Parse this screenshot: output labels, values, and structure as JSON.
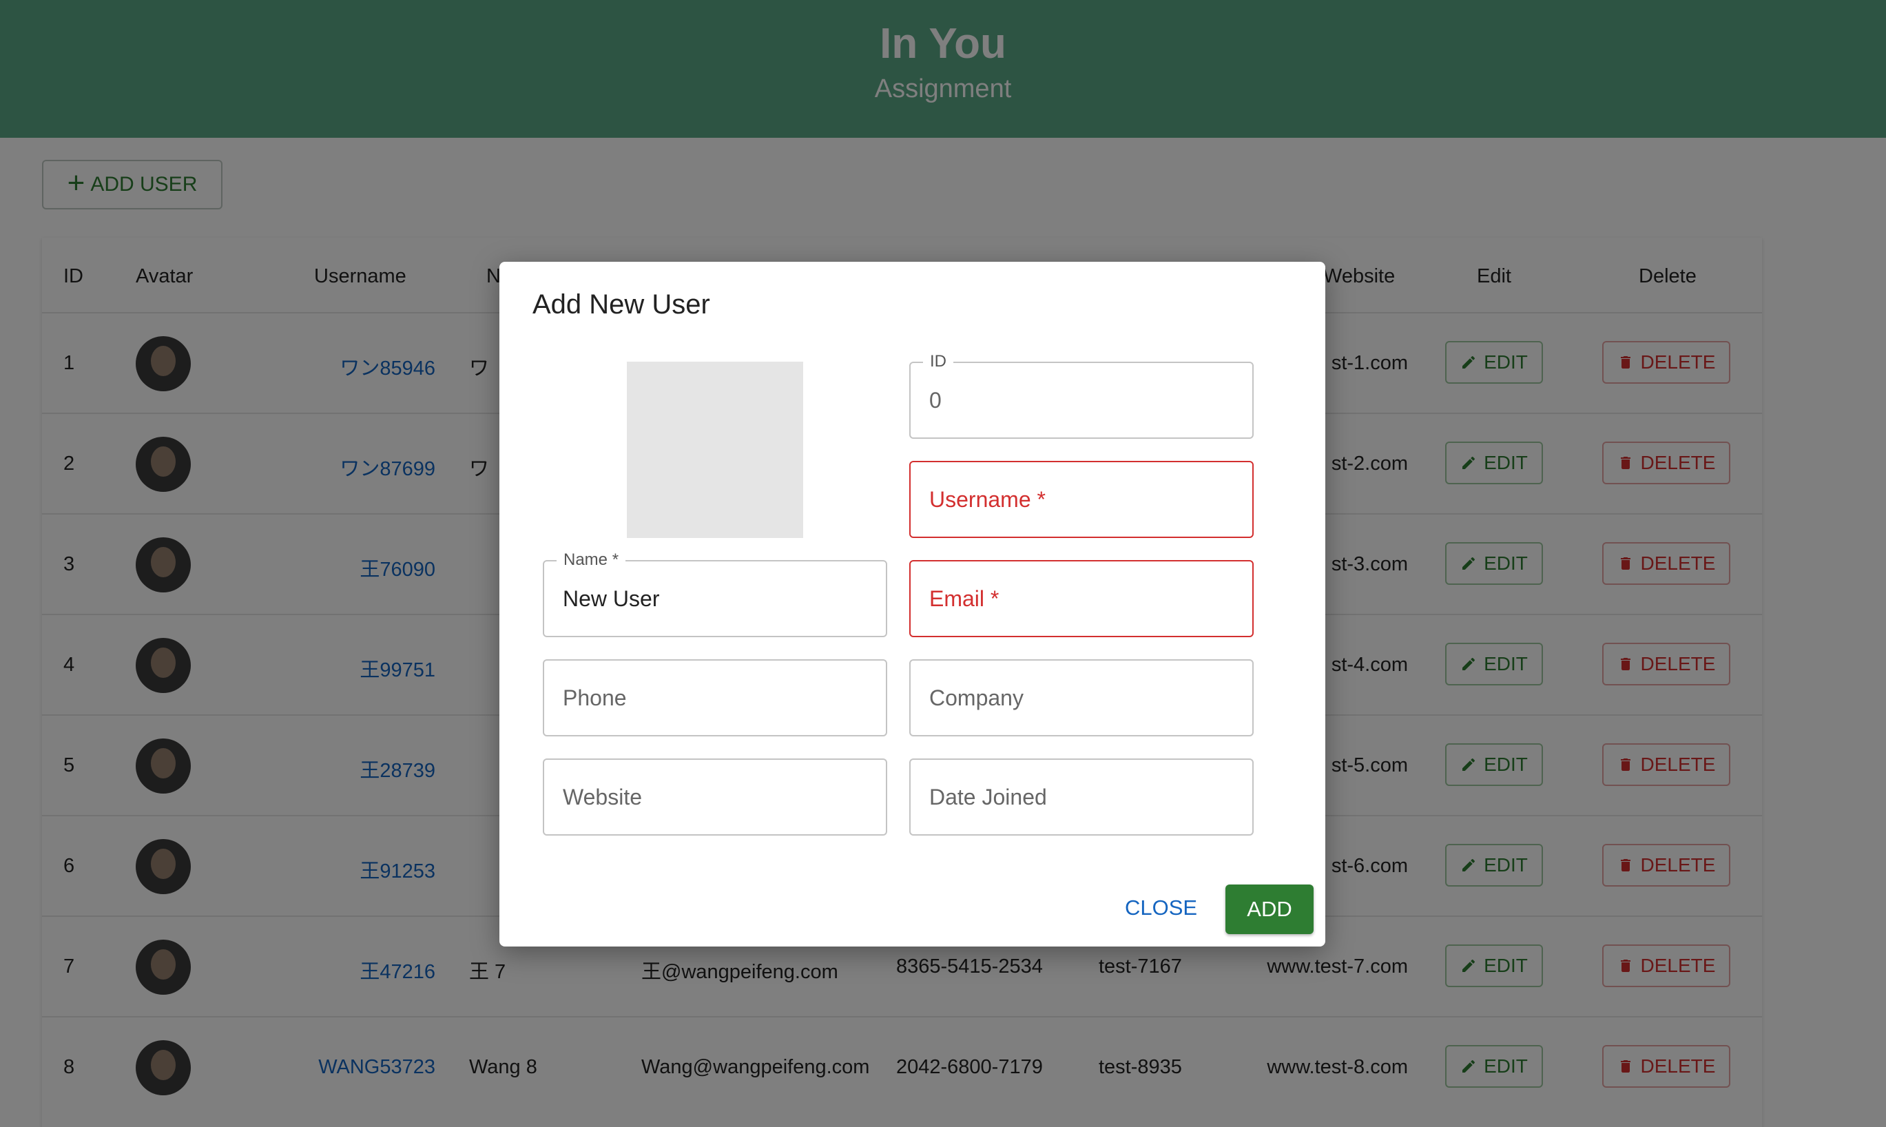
{
  "header": {
    "title": "In You",
    "subtitle": "Assignment"
  },
  "toolbar": {
    "add_user_label": "ADD USER"
  },
  "table": {
    "columns": {
      "id": "ID",
      "avatar": "Avatar",
      "username": "Username",
      "name": "N",
      "website": "Website",
      "edit": "Edit",
      "delete": "Delete"
    },
    "edit_label": "EDIT",
    "delete_label": "DELETE",
    "rows": [
      {
        "id": "1",
        "username": "ワン85946",
        "name": "ワ",
        "email": "",
        "phone": "",
        "company": "",
        "website": "st-1.com"
      },
      {
        "id": "2",
        "username": "ワン87699",
        "name": "ワ",
        "email": "",
        "phone": "",
        "company": "",
        "website": "st-2.com"
      },
      {
        "id": "3",
        "username": "王76090",
        "name": "",
        "email": "",
        "phone": "",
        "company": "",
        "website": "st-3.com"
      },
      {
        "id": "4",
        "username": "王99751",
        "name": "",
        "email": "",
        "phone": "",
        "company": "",
        "website": "st-4.com"
      },
      {
        "id": "5",
        "username": "王28739",
        "name": "",
        "email": "",
        "phone": "",
        "company": "",
        "website": "st-5.com"
      },
      {
        "id": "6",
        "username": "王91253",
        "name": "",
        "email": "",
        "phone": "",
        "company": "",
        "website": "st-6.com"
      },
      {
        "id": "7",
        "username": "王47216",
        "name": "王 7",
        "email": "王@wangpeifeng.com",
        "phone": "8365-5415-2534",
        "company": "test-7167",
        "website": "www.test-7.com"
      },
      {
        "id": "8",
        "username": "WANG53723",
        "name": "Wang 8",
        "email": "Wang@wangpeifeng.com",
        "phone": "2042-6800-7179",
        "company": "test-8935",
        "website": "www.test-8.com"
      }
    ]
  },
  "dialog": {
    "title": "Add New User",
    "fields": {
      "id": {
        "legend": "ID",
        "value": "0"
      },
      "username": {
        "placeholder": "Username *"
      },
      "name": {
        "legend": "Name *",
        "value": "New User"
      },
      "email": {
        "placeholder": "Email *"
      },
      "phone": {
        "placeholder": "Phone"
      },
      "company": {
        "placeholder": "Company"
      },
      "website": {
        "placeholder": "Website"
      },
      "date_joined": {
        "placeholder": "Date Joined"
      }
    },
    "close_label": "CLOSE",
    "add_label": "ADD"
  },
  "colors": {
    "header": "#5ba886",
    "primary": "#2e7d32",
    "error": "#d32f2f",
    "link": "#1565c0"
  },
  "icons": {
    "add": "plus-icon",
    "edit": "pencil-icon",
    "delete": "trash-icon"
  }
}
